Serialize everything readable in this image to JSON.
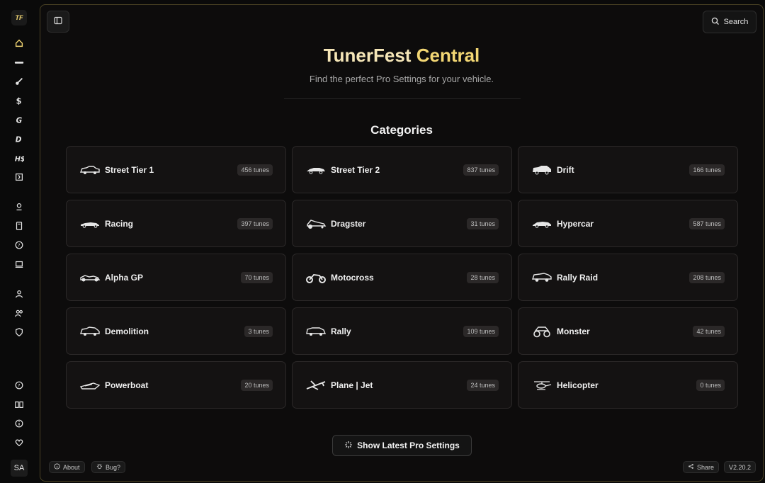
{
  "rail": {
    "logo_text": "TF",
    "avatar_text": "SA",
    "icons": [
      "home-icon",
      "car-icon",
      "guitar-icon",
      "dollar-icon",
      "gauge-icon",
      "speed-icon",
      "hs-icon",
      "flag-icon",
      "map-pin-icon",
      "book-icon",
      "help-icon",
      "monitor-icon",
      "user-icon",
      "users-icon",
      "shield-icon",
      "help-circle-icon",
      "book-open-icon",
      "info-icon",
      "heart-icon"
    ]
  },
  "header": {
    "search_label": "Search",
    "title_part1": "TunerFest",
    "title_part2": "Central",
    "subtitle": "Find the perfect Pro Settings for your vehicle."
  },
  "categories": {
    "heading": "Categories",
    "items": [
      {
        "label": "Street Tier 1",
        "count": "456 tunes",
        "icon": "street-car-icon"
      },
      {
        "label": "Street Tier 2",
        "count": "837 tunes",
        "icon": "sports-car-icon"
      },
      {
        "label": "Drift",
        "count": "166 tunes",
        "icon": "drift-car-icon"
      },
      {
        "label": "Racing",
        "count": "397 tunes",
        "icon": "race-car-icon"
      },
      {
        "label": "Dragster",
        "count": "31 tunes",
        "icon": "dragster-icon"
      },
      {
        "label": "Hypercar",
        "count": "587 tunes",
        "icon": "hypercar-icon"
      },
      {
        "label": "Alpha GP",
        "count": "70 tunes",
        "icon": "formula-car-icon"
      },
      {
        "label": "Motocross",
        "count": "28 tunes",
        "icon": "motorbike-icon"
      },
      {
        "label": "Rally Raid",
        "count": "208 tunes",
        "icon": "rally-raid-icon"
      },
      {
        "label": "Demolition",
        "count": "3 tunes",
        "icon": "demolition-car-icon"
      },
      {
        "label": "Rally",
        "count": "109 tunes",
        "icon": "rally-car-icon"
      },
      {
        "label": "Monster",
        "count": "42 tunes",
        "icon": "monster-truck-icon"
      },
      {
        "label": "Powerboat",
        "count": "20 tunes",
        "icon": "powerboat-icon"
      },
      {
        "label": "Plane | Jet",
        "count": "24 tunes",
        "icon": "plane-icon"
      },
      {
        "label": "Helicopter",
        "count": "0 tunes",
        "icon": "helicopter-icon"
      }
    ]
  },
  "footer": {
    "latest_label": "Show Latest Pro Settings",
    "about_label": "About",
    "bug_label": "Bug?",
    "share_label": "Share",
    "version": "V2.20.2"
  },
  "colors": {
    "accent": "#f3d774",
    "border": "#4a4224"
  }
}
